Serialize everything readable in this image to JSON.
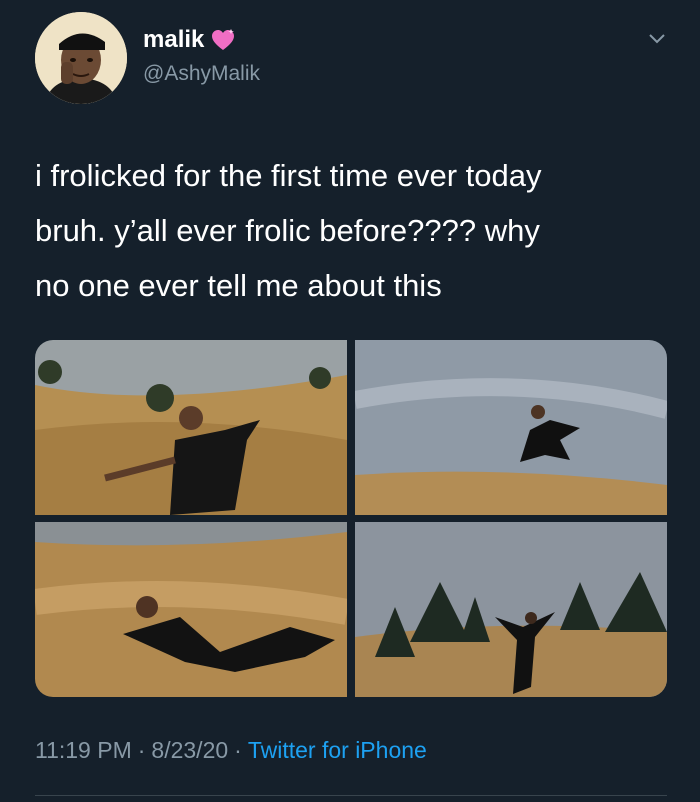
{
  "tweet": {
    "display_name": "malik",
    "name_emoji_icon": "sparkling-heart-icon",
    "handle": "@AshyMalik",
    "text": "i frolicked for the first time ever today\nbruh. y’all ever frolic before???? why\nno one ever tell me about this",
    "media": [
      {
        "icon": "photo-frolic-standing"
      },
      {
        "icon": "photo-frolic-jumping"
      },
      {
        "icon": "photo-frolic-lying-in-grass"
      },
      {
        "icon": "photo-frolic-arms-out-hilltop"
      }
    ],
    "time": "11:19 PM",
    "date": "8/23/20",
    "source": "Twitter for iPhone",
    "separator": "·"
  },
  "colors": {
    "background": "#15202b",
    "text": "#ffffff",
    "secondary": "#8899a6",
    "link": "#1da1f2"
  }
}
